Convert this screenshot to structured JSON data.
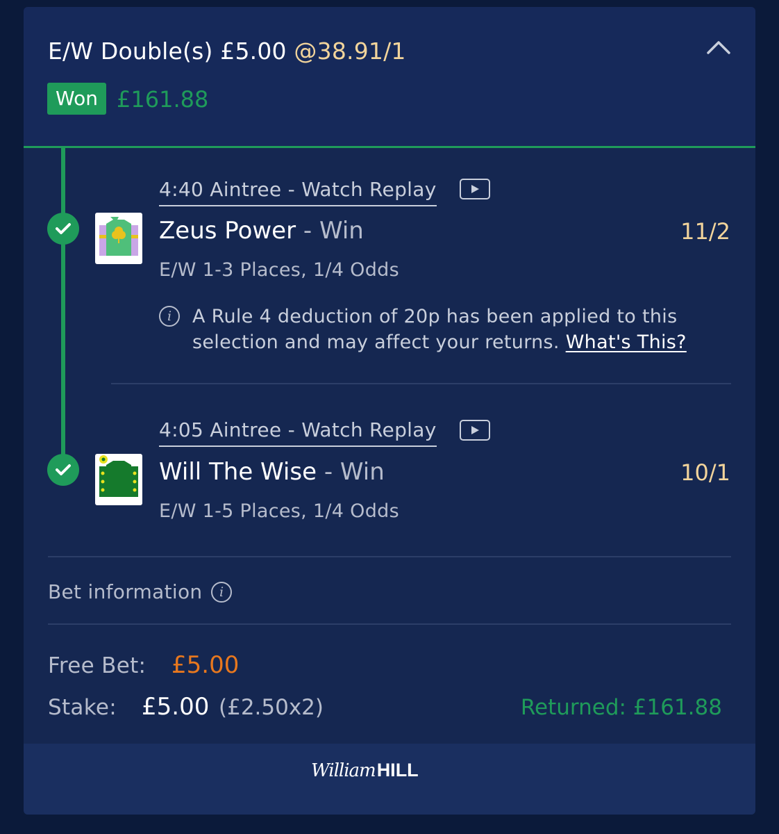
{
  "bet": {
    "title_prefix": "E/W Double(s) £5.00 ",
    "title_odds": "@38.91/1",
    "status": "Won",
    "won_amount": "£161.88"
  },
  "selections": [
    {
      "race": "4:40 Aintree - Watch Replay",
      "runner": "Zeus Power",
      "result": " - Win",
      "price": "11/2",
      "terms": "E/W 1-3 Places, 1/4 Odds",
      "rule4_text": "A Rule 4 deduction of 20p has been applied to this selection and may affect your returns. ",
      "rule4_link": "What's This?"
    },
    {
      "race": "4:05 Aintree - Watch Replay",
      "runner": "Will The Wise",
      "result": " - Win",
      "price": "10/1",
      "terms": "E/W 1-5 Places, 1/4 Odds"
    }
  ],
  "bet_information_label": "Bet information",
  "free_bet": {
    "label": "Free Bet:",
    "value": "£5.00"
  },
  "stake": {
    "label": "Stake:",
    "value": "£5.00",
    "split": "(£2.50x2)"
  },
  "returned": "Returned: £161.88",
  "brand": {
    "script": "William",
    "bold": "HILL"
  },
  "colors": {
    "background": "#0b1a3a",
    "card": "#152751",
    "green": "#1f9b5a",
    "odds": "#f2d49b",
    "free_bet": "#e8781e"
  },
  "icons": [
    "chevron-up-icon",
    "check-icon",
    "play-icon",
    "info-icon",
    "silks-image"
  ]
}
